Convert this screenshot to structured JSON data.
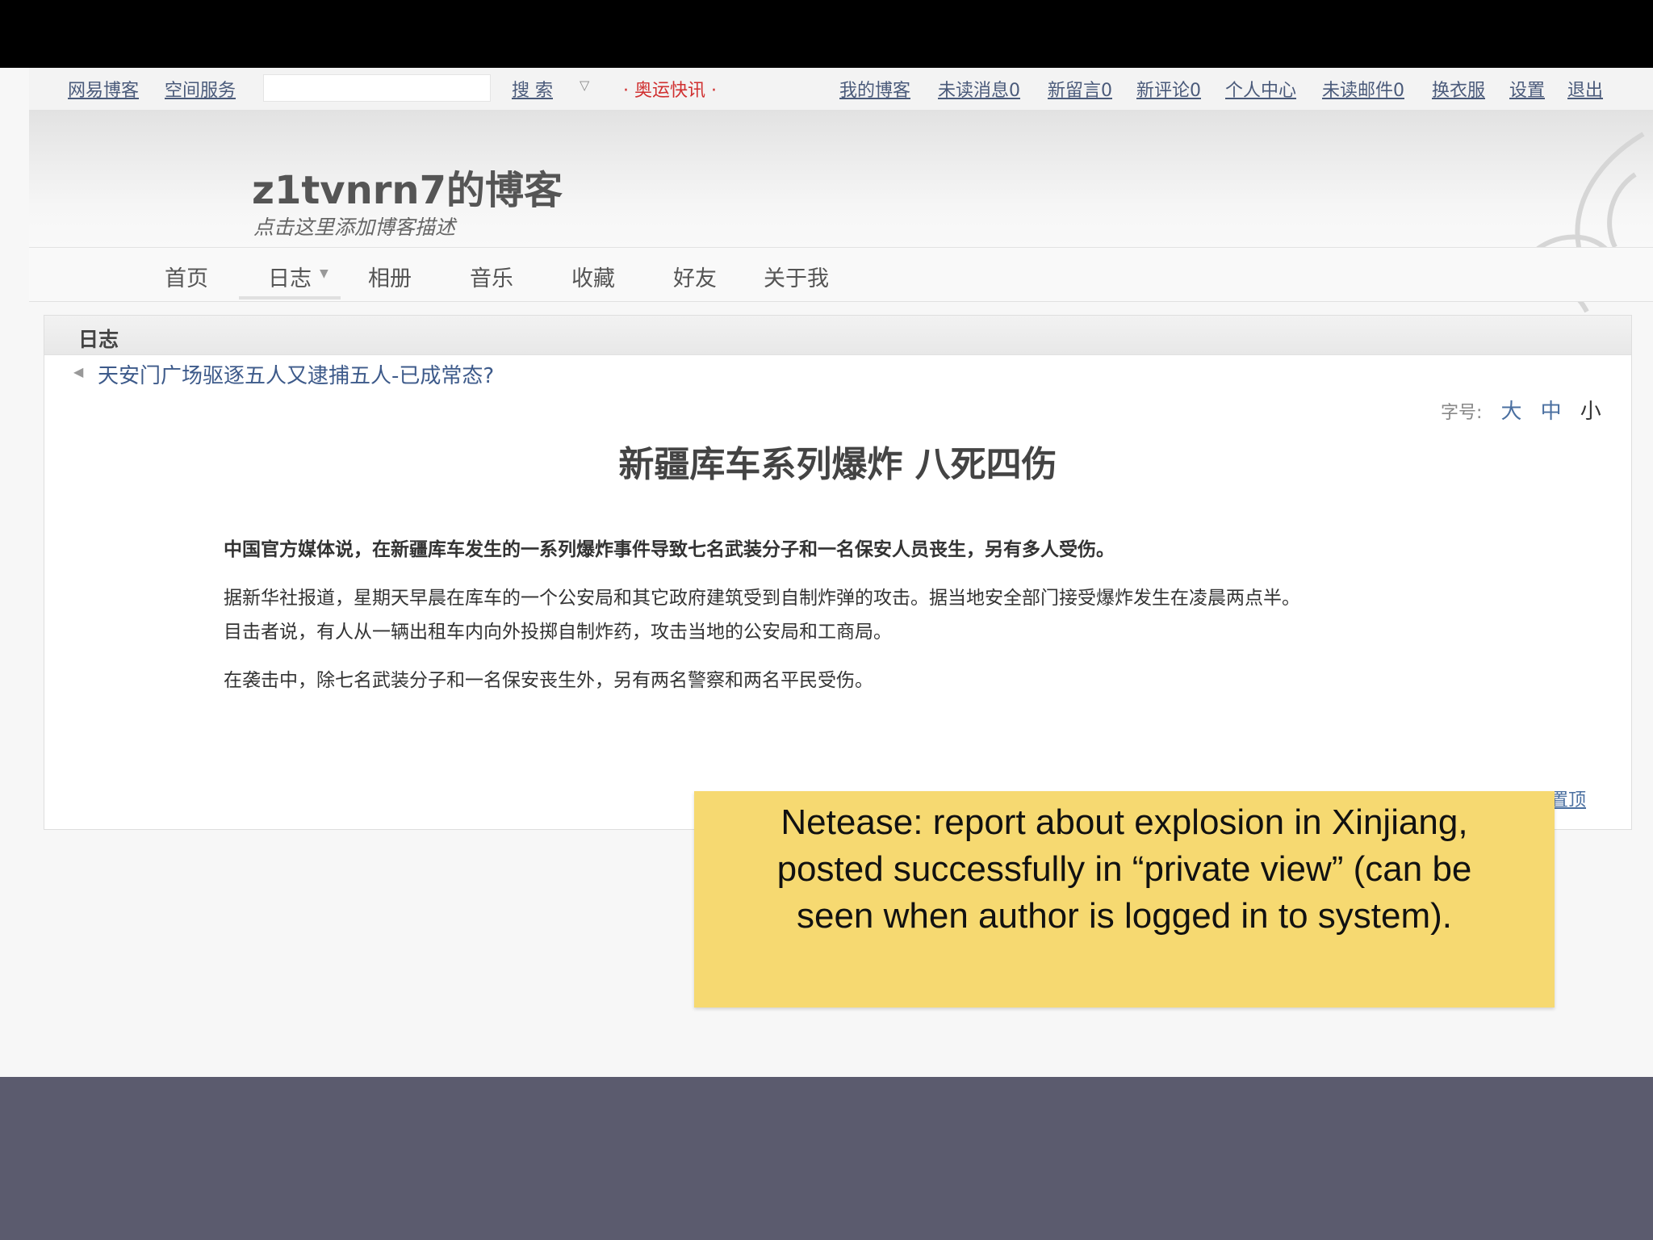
{
  "nav": {
    "left_links": [
      "网易博客",
      "空间服务"
    ],
    "search_button": "搜 索",
    "olympic_news": "· 奥运快讯 ·",
    "right_links": [
      "我的博客",
      "未读消息0",
      "新留言0",
      "新评论0",
      "个人中心",
      "未读邮件0",
      "换衣服",
      "设置",
      "退出"
    ]
  },
  "header": {
    "title": "z1tvnrn7的博客",
    "description": "点击这里添加博客描述"
  },
  "tabs": [
    "首页",
    "日志",
    "相册",
    "音乐",
    "收藏",
    "好友",
    "关于我"
  ],
  "panel": {
    "title": "日志",
    "prev_post": "天安门广场驱逐五人又逮捕五人-已成常态?",
    "font_size_label": "字号:",
    "font_sizes": [
      "大",
      "中",
      "小"
    ],
    "back_to_top": "置顶"
  },
  "article": {
    "title": "新疆库车系列爆炸 八死四伤",
    "paragraphs": [
      "中国官方媒体说，在新疆库车发生的一系列爆炸事件导致七名武装分子和一名保安人员丧生，另有多人受伤。",
      "据新华社报道，星期天早晨在库车的一个公安局和其它政府建筑受到自制炸弹的攻击。据当地安全部门接受爆炸发生在凌晨两点半。",
      "目击者说，有人从一辆出租车内向外投掷自制炸药，攻击当地的公安局和工商局。",
      "在袭击中，除七名武装分子和一名保安丧生外，另有两名警察和两名平民受伤。"
    ]
  },
  "annotation": {
    "lines": [
      "Netease: report about explosion in Xinjiang,",
      "posted successfully in “private view” (can be",
      "seen when author is logged in to system)."
    ]
  }
}
